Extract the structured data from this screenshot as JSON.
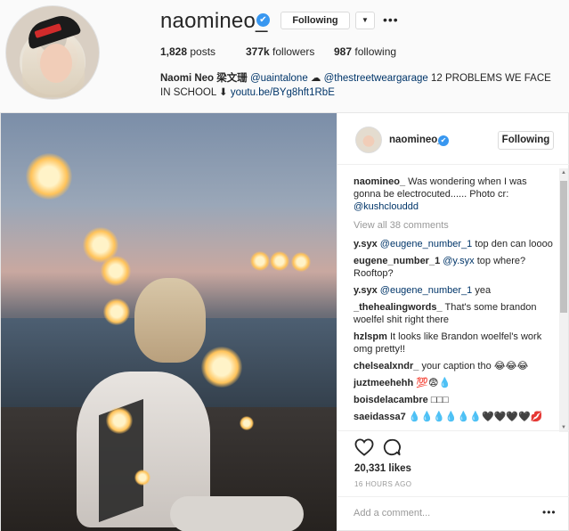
{
  "profile": {
    "username": "naomineo_",
    "verified_mark": "✔",
    "follow_label": "Following",
    "dropdown_icon": "▼",
    "more_icon": "•••",
    "stats": {
      "posts": "1,828",
      "posts_label": "posts",
      "followers": "377k",
      "followers_label": "followers",
      "following": "987",
      "following_label": "following"
    },
    "bio": {
      "name": "Naomi Neo 梁文珊",
      "mention1": "@uaintalone",
      "emoji": "☁",
      "mention2": "@thestreetweargarage",
      "text": "12 PROBLEMS WE FACE IN SCHOOL ⬇",
      "link": "youtu.be/BYg8hft1RbE"
    }
  },
  "post": {
    "username": "naomineo_",
    "verified_mark": "✔",
    "follow_label": "Following",
    "caption": {
      "user": "naomineo_",
      "text": "Was wondering when I was gonna be electrocuted...... Photo cr:",
      "mention": "@kushclouddd"
    },
    "view_all": "View all 38 comments",
    "comments": [
      {
        "user": "y.syx",
        "mention": "@eugene_number_1",
        "text": "top den can loooo"
      },
      {
        "user": "eugene_number_1",
        "mention": "@y.syx",
        "text": "top where? Rooftop?"
      },
      {
        "user": "y.syx",
        "mention": "@eugene_number_1",
        "text": "yea"
      },
      {
        "user": "_thehealingwords_",
        "mention": "",
        "text": "That's some brandon woelfel shit right there"
      },
      {
        "user": "hzlspm",
        "mention": "",
        "text": "It looks like Brandon woelfel's work omg pretty!!"
      },
      {
        "user": "chelsealxndr_",
        "mention": "",
        "text": "your caption tho 😂😂😂"
      },
      {
        "user": "juztmeehehh",
        "mention": "",
        "text": "💯😨💧"
      },
      {
        "user": "boisdelacambre",
        "mention": "",
        "text": "□□□"
      },
      {
        "user": "saeidassa7",
        "mention": "",
        "text": "💧💧💧💧💧💧🖤🖤🖤🖤💋"
      }
    ],
    "likes": "20,331 likes",
    "time": "16 HOURS AGO",
    "add_comment_placeholder": "Add a comment...",
    "more_icon": "•••"
  },
  "icons": {
    "heart": "heart-icon",
    "comment": "comment-icon",
    "verified": "verified-badge-icon"
  },
  "colors": {
    "verified": "#3897f0",
    "link": "#003569",
    "muted": "#999999"
  }
}
